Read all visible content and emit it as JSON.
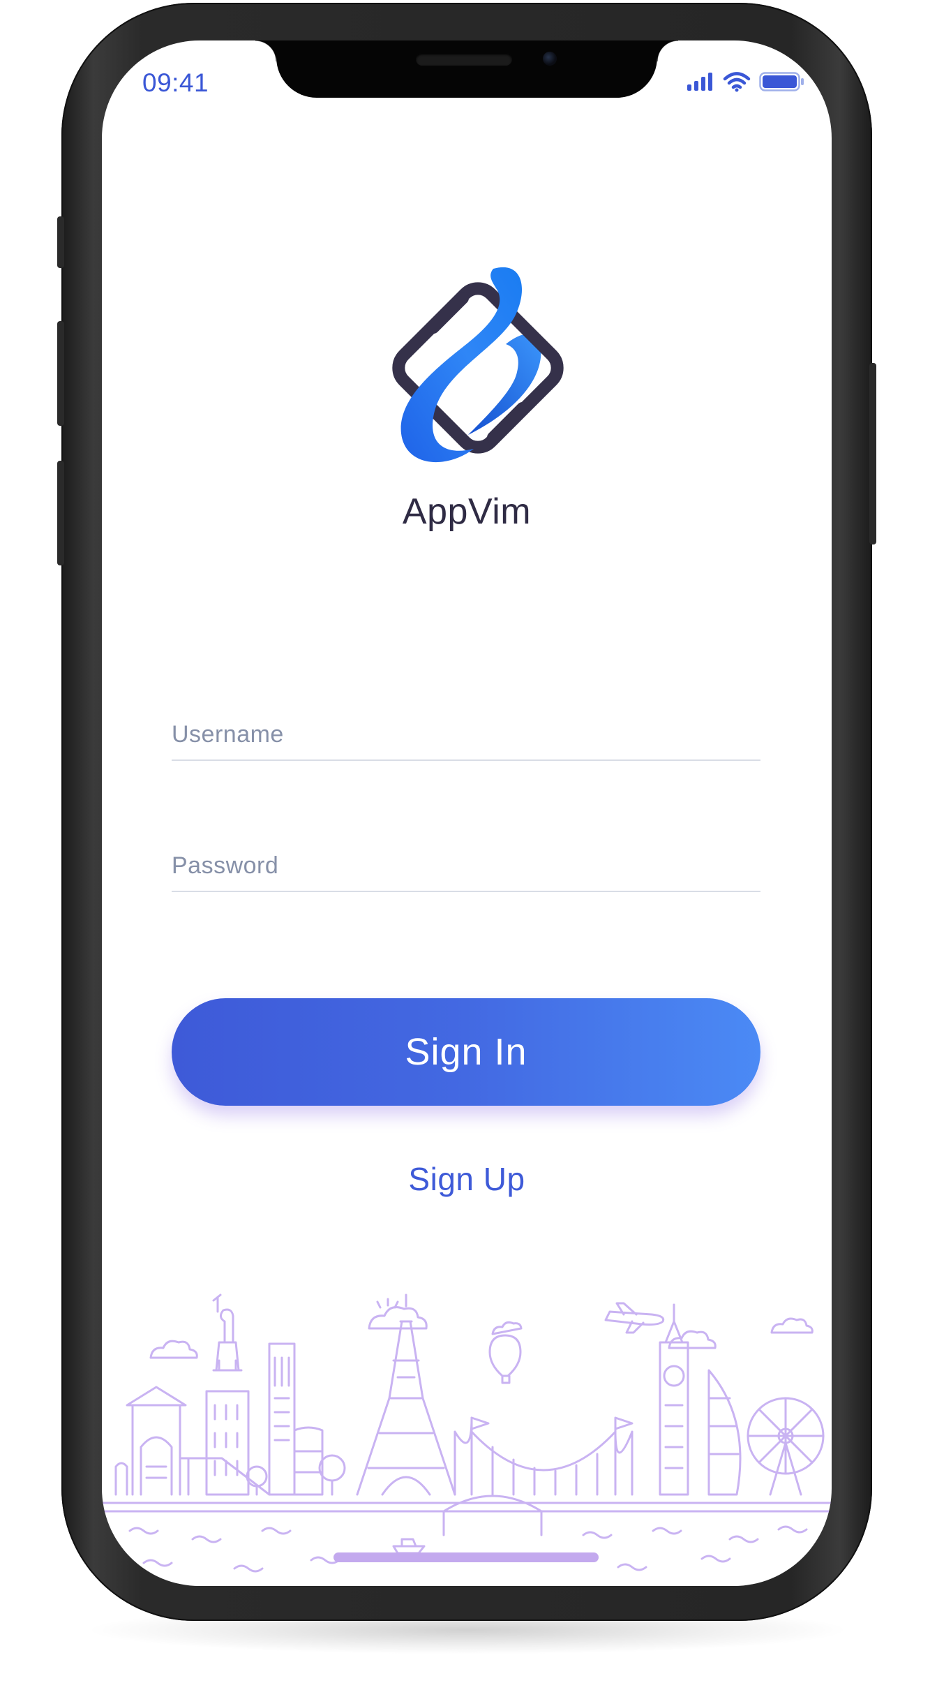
{
  "status_bar": {
    "time": "09:41",
    "icons": [
      "signal-icon",
      "wifi-icon",
      "battery-icon"
    ]
  },
  "brand": {
    "app_name": "AppVim",
    "logo_icon": "appvim-logo-icon"
  },
  "form": {
    "username_placeholder": "Username",
    "password_placeholder": "Password",
    "username_value": "",
    "password_value": ""
  },
  "actions": {
    "sign_in_label": "Sign In",
    "sign_up_label": "Sign Up"
  },
  "illustration": {
    "icon": "city-skyline-illustration"
  },
  "colors": {
    "accent": "#3e5ad8",
    "accent_light": "#4b8af5",
    "text_dark": "#2f2b44",
    "placeholder": "#8690a8",
    "illustration": "#c9b3f2"
  }
}
